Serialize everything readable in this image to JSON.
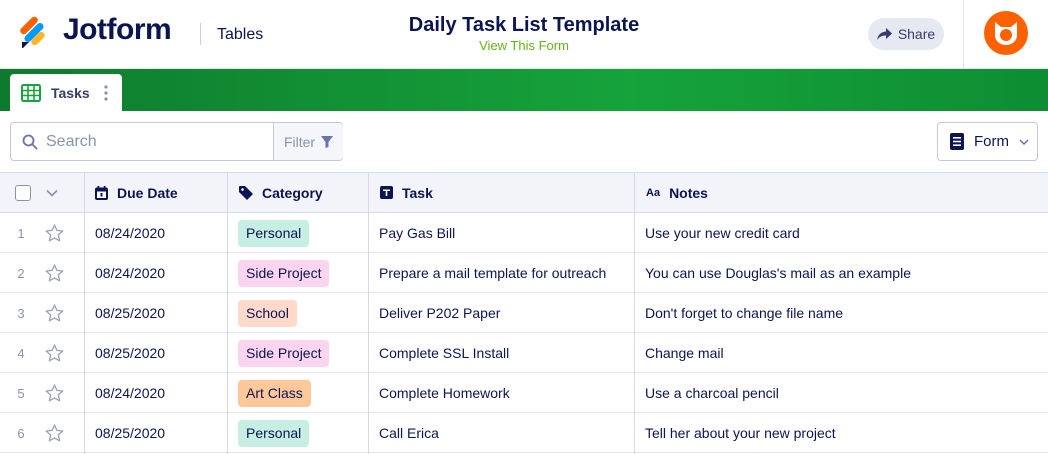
{
  "header": {
    "brand": "Jotform",
    "app_name": "Tables",
    "title": "Daily Task List Template",
    "view_form_link": "View This Form",
    "share_label": "Share"
  },
  "tabs": [
    {
      "label": "Tasks",
      "icon": "table-grid-icon",
      "active": true
    }
  ],
  "toolbar": {
    "search_placeholder": "Search",
    "filter_label": "Filter",
    "form_label": "Form"
  },
  "columns": [
    {
      "label": "Due Date",
      "icon": "calendar-icon"
    },
    {
      "label": "Category",
      "icon": "tag-icon"
    },
    {
      "label": "Task",
      "icon": "text-icon"
    },
    {
      "label": "Notes",
      "icon": "long-text-icon"
    }
  ],
  "rows": [
    {
      "num": "1",
      "date": "08/24/2020",
      "category": "Personal",
      "task": "Pay Gas Bill",
      "notes": "Use your new credit card"
    },
    {
      "num": "2",
      "date": "08/24/2020",
      "category": "Side Project",
      "task": "Prepare a mail template for outreach",
      "notes": "You can use Douglas's mail as an example"
    },
    {
      "num": "3",
      "date": "08/25/2020",
      "category": "School",
      "task": "Deliver P202 Paper",
      "notes": "Don't forget to change file name"
    },
    {
      "num": "4",
      "date": "08/25/2020",
      "category": "Side Project",
      "task": "Complete SSL Install",
      "notes": "Change mail"
    },
    {
      "num": "5",
      "date": "08/24/2020",
      "category": "Art Class",
      "task": "Complete Homework",
      "notes": "Use a charcoal pencil"
    },
    {
      "num": "6",
      "date": "08/25/2020",
      "category": "Personal",
      "task": "Call Erica",
      "notes": "Tell her about your new project"
    }
  ],
  "category_colors": {
    "Personal": "#c7eee3",
    "Side Project": "#fbd5ef",
    "School": "#ffd9c9",
    "Art Class": "#ffc89a"
  },
  "colors": {
    "brand_dark": "#0a1551",
    "tab_bar_green": "#16a33a",
    "link_green": "#64b315",
    "avatar_orange": "#ff6100"
  }
}
